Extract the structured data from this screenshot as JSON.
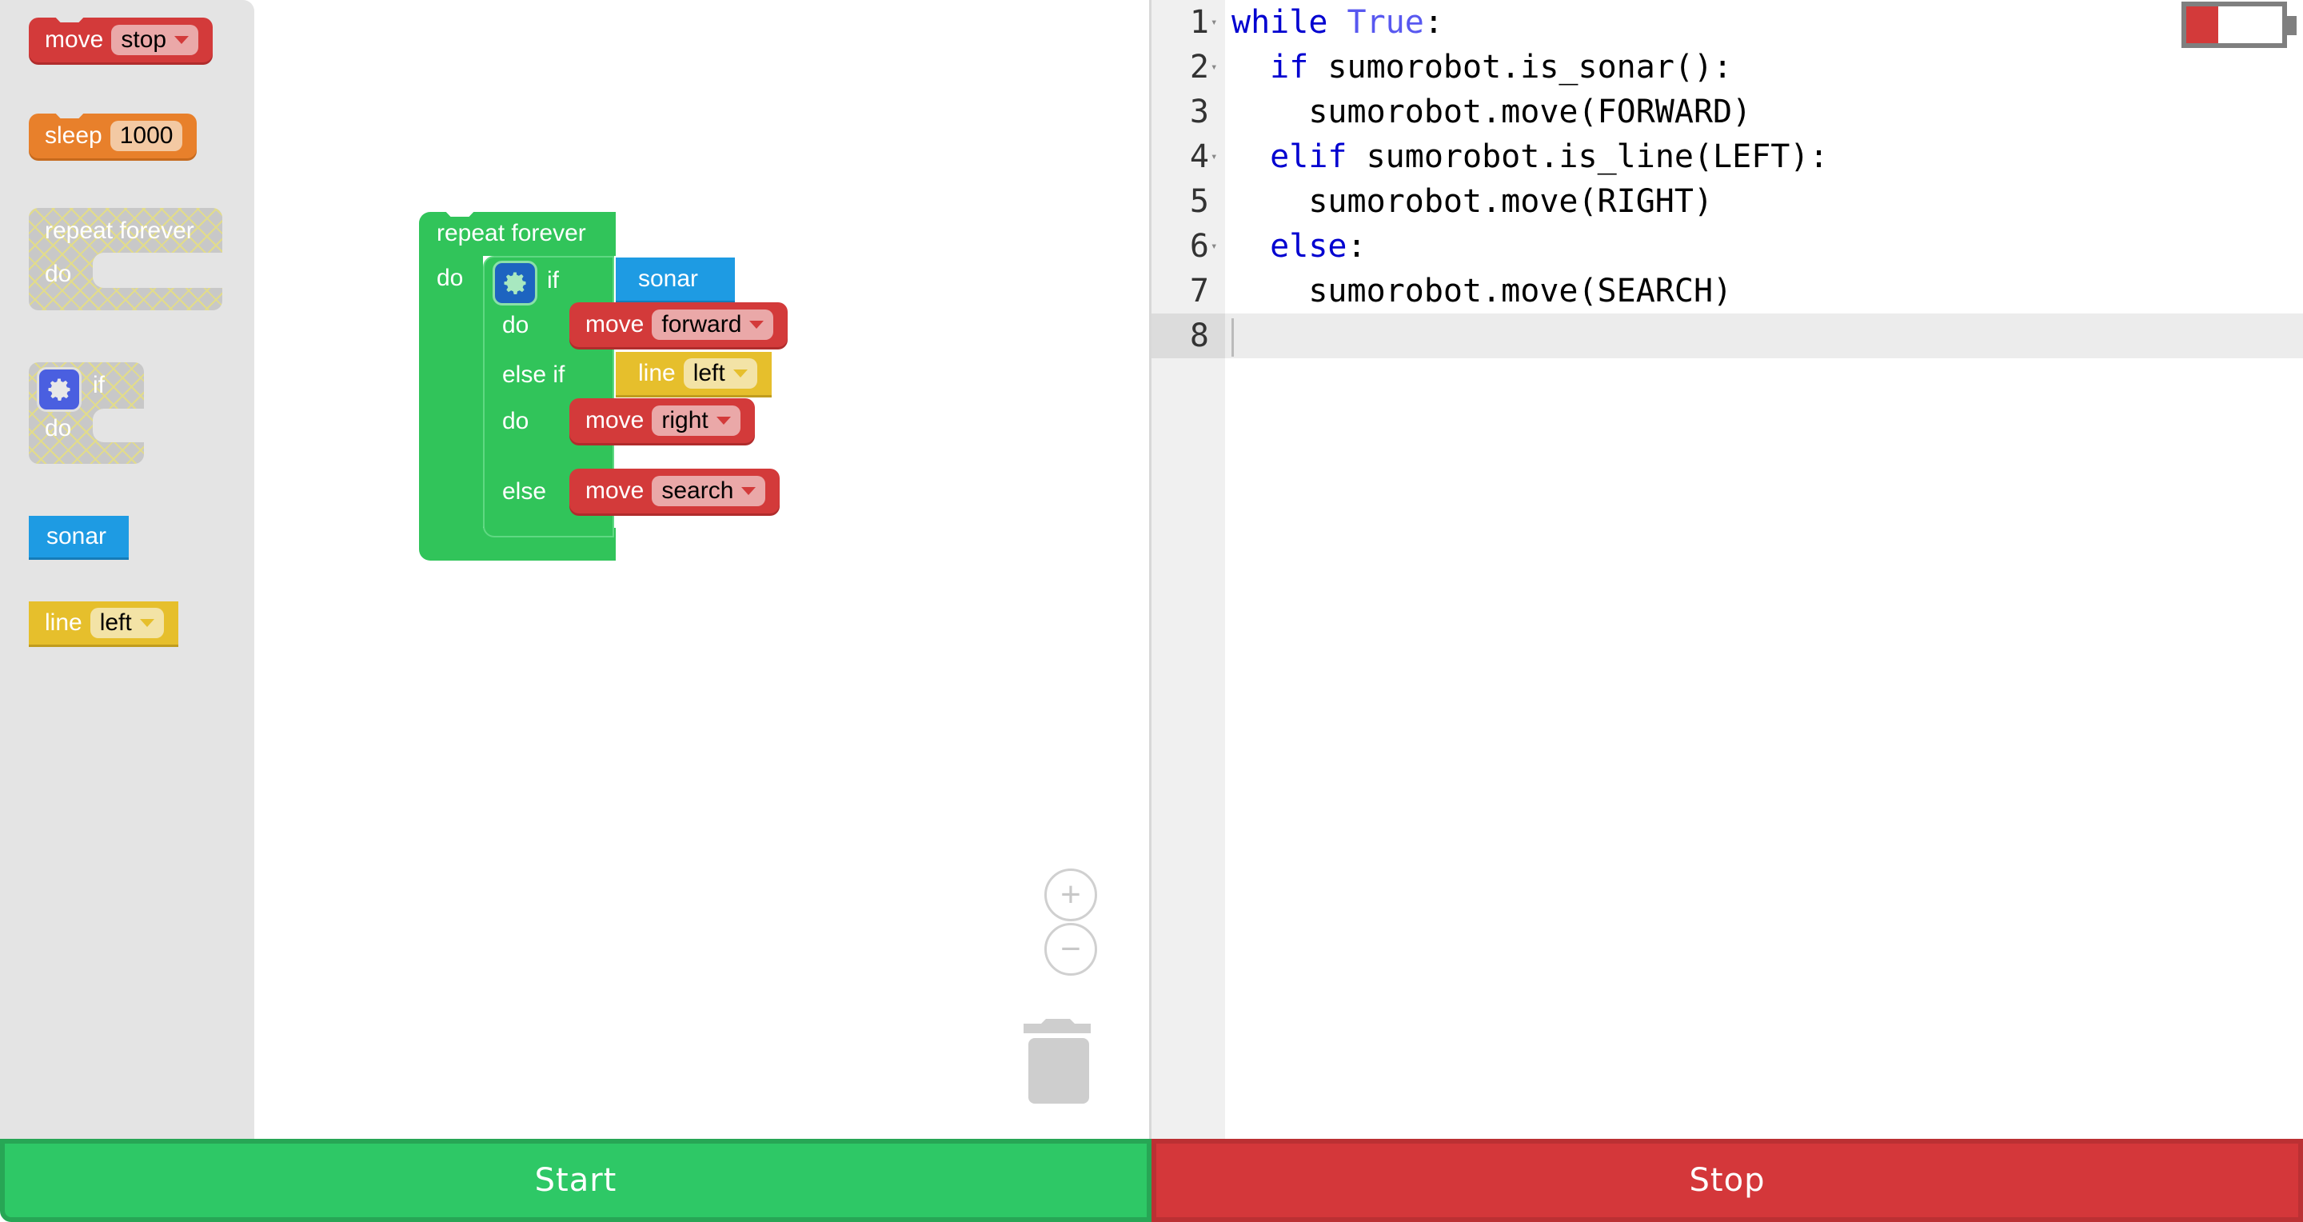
{
  "toolbox": {
    "move_block": {
      "label": "move",
      "value": "stop"
    },
    "sleep_block": {
      "label": "sleep",
      "value": "1000"
    },
    "repeat_block": {
      "label": "repeat forever",
      "do": "do"
    },
    "if_block": {
      "if": "if",
      "do": "do"
    },
    "sonar_block": {
      "label": "sonar"
    },
    "line_block": {
      "label": "line",
      "value": "left"
    }
  },
  "workspace": {
    "repeat": {
      "label": "repeat forever",
      "do": "do"
    },
    "if": {
      "if": "if",
      "condition1": "sonar",
      "do1": "do",
      "action1": {
        "label": "move",
        "value": "forward"
      },
      "elseif": "else if",
      "condition2": {
        "label": "line",
        "value": "left"
      },
      "do2": "do",
      "action2": {
        "label": "move",
        "value": "right"
      },
      "else": "else",
      "action3": {
        "label": "move",
        "value": "search"
      }
    },
    "zoom_in": "+",
    "zoom_out": "−"
  },
  "editor": {
    "lines": [
      {
        "n": "1",
        "fold": true,
        "segments": [
          {
            "t": "while",
            "c": "kw"
          },
          {
            "t": " "
          },
          {
            "t": "True",
            "c": "const"
          },
          {
            "t": ":"
          }
        ]
      },
      {
        "n": "2",
        "fold": true,
        "segments": [
          {
            "t": "  "
          },
          {
            "t": "if",
            "c": "kw"
          },
          {
            "t": " sumorobot.is_sonar():"
          }
        ]
      },
      {
        "n": "3",
        "fold": false,
        "segments": [
          {
            "t": "    sumorobot.move(FORWARD)"
          }
        ]
      },
      {
        "n": "4",
        "fold": true,
        "segments": [
          {
            "t": "  "
          },
          {
            "t": "elif",
            "c": "kw"
          },
          {
            "t": " sumorobot.is_line(LEFT):"
          }
        ]
      },
      {
        "n": "5",
        "fold": false,
        "segments": [
          {
            "t": "    sumorobot.move(RIGHT)"
          }
        ]
      },
      {
        "n": "6",
        "fold": true,
        "segments": [
          {
            "t": "  "
          },
          {
            "t": "else",
            "c": "kw"
          },
          {
            "t": ":"
          }
        ]
      },
      {
        "n": "7",
        "fold": false,
        "segments": [
          {
            "t": "    sumorobot.move(SEARCH)"
          }
        ]
      },
      {
        "n": "8",
        "fold": false,
        "segments": [],
        "active": true
      }
    ]
  },
  "battery": {
    "level_percent": 33,
    "color": "#d33a3a"
  },
  "buttons": {
    "start": "Start",
    "stop": "Stop"
  },
  "colors": {
    "start": "#2ec866",
    "stop": "#d4373a",
    "move": "#d33a3a",
    "sleep": "#e8802b",
    "control": "#31c45a",
    "sonar": "#1e9be3",
    "line": "#e6bf2c"
  }
}
